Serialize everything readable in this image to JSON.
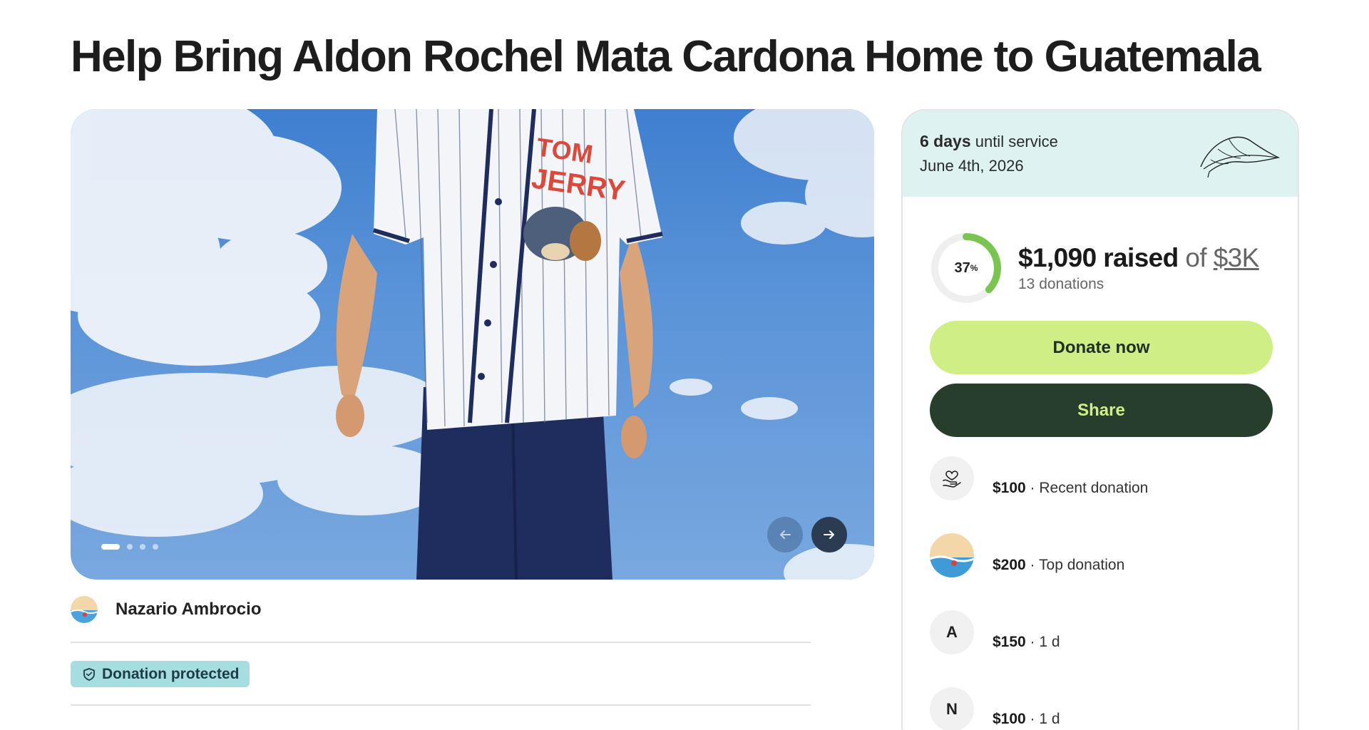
{
  "page_title": "Help Bring Aldon Rochel Mata Cardona Home to Guatemala",
  "hero": {
    "shirt_text_1": "TOM",
    "shirt_text_2": "JERRY",
    "slide_count": 4,
    "active_slide": 1
  },
  "organizer": {
    "name": "Nazario Ambrocio"
  },
  "badge": {
    "label": "Donation protected"
  },
  "service": {
    "days": "6 days",
    "until_text": " until service",
    "date": "June 4th, 2026"
  },
  "progress": {
    "percent_number": "37",
    "percent_sign": "%",
    "percent_value": 37,
    "raised": "$1,090 raised",
    "of_text": " of ",
    "goal": "$3K",
    "donations": "13 donations"
  },
  "buttons": {
    "donate": "Donate now",
    "share": "Share"
  },
  "donations": [
    {
      "amount": "$100",
      "sep": " · ",
      "label": "Recent donation",
      "avatar": "heart-hand-icon"
    },
    {
      "amount": "$200",
      "sep": " · ",
      "label": "Top donation",
      "avatar": "beach-photo"
    },
    {
      "amount": "$150",
      "sep": " · ",
      "label": "1 d",
      "initial": "A"
    },
    {
      "amount": "$100",
      "sep": " · ",
      "label": "1 d",
      "initial": "N"
    }
  ],
  "colors": {
    "donate_bg": "#cfee86",
    "share_bg": "#283e2c",
    "badge_bg": "#a5dde0",
    "card_top_bg": "#dff2f2",
    "progress_green": "#7cc451"
  }
}
